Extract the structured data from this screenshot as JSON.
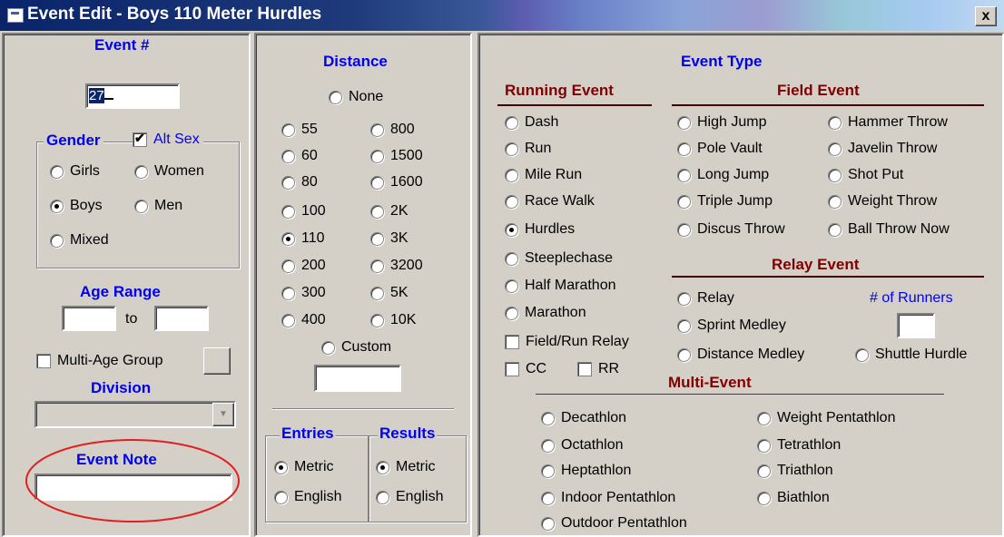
{
  "window": {
    "title": "Event Edit  -  Boys 110 Meter Hurdles",
    "close_label": "x"
  },
  "left": {
    "event_num_label": "Event #",
    "event_num_value": "27",
    "gender_label": "Gender",
    "alt_sex_label": "Alt Sex",
    "gender_options": [
      "Girls",
      "Women",
      "Boys",
      "Men",
      "Mixed"
    ],
    "gender_selected": "Boys",
    "age_range_label": "Age Range",
    "age_to_label": "to",
    "multi_age_label": "Multi-Age Group",
    "division_label": "Division",
    "division_value": "",
    "event_note_label": "Event Note",
    "event_note_value": ""
  },
  "distance": {
    "header": "Distance",
    "none_label": "None",
    "col1": [
      "55",
      "60",
      "80",
      "100",
      "110",
      "200",
      "300",
      "400"
    ],
    "col2": [
      "800",
      "1500",
      "1600",
      "2K",
      "3K",
      "3200",
      "5K",
      "10K"
    ],
    "selected": "110",
    "custom_label": "Custom",
    "custom_value": "",
    "entries_label": "Entries",
    "results_label": "Results",
    "entries_options": [
      "Metric",
      "English"
    ],
    "results_options": [
      "Metric",
      "English"
    ],
    "entries_selected": "Metric",
    "results_selected": "Metric"
  },
  "event_type": {
    "header": "Event Type",
    "running_header": "Running Event",
    "running": [
      "Dash",
      "Run",
      "Mile Run",
      "Race Walk",
      "Hurdles",
      "Steeplechase",
      "Half Marathon",
      "Marathon"
    ],
    "running_selected": "Hurdles",
    "field_run_relay_label": "Field/Run Relay",
    "cc_label": "CC",
    "rr_label": "RR",
    "field_header": "Field Event",
    "field_col1": [
      "High Jump",
      "Pole Vault",
      "Long Jump",
      "Triple Jump",
      "Discus Throw"
    ],
    "field_col2": [
      "Hammer Throw",
      "Javelin Throw",
      "Shot Put",
      "Weight Throw",
      "Ball Throw Now"
    ],
    "relay_header": "Relay Event",
    "relay": [
      "Relay",
      "Sprint Medley",
      "Distance Medley"
    ],
    "shuttle_label": "Shuttle Hurdle",
    "runners_label": "# of Runners",
    "runners_value": "",
    "multi_header": "Multi-Event",
    "multi_col1": [
      "Decathlon",
      "Octathlon",
      "Heptathlon",
      "Indoor Pentathlon",
      "Outdoor Pentathlon"
    ],
    "multi_col2": [
      "Weight Pentathlon",
      "Tetrathlon",
      "Triathlon",
      "Biathlon"
    ]
  },
  "colors": {
    "header_blue": "#0000ee",
    "header_dark": "#800000",
    "title_bar": "#0a246a",
    "highlight_ellipse": "#e02020"
  }
}
